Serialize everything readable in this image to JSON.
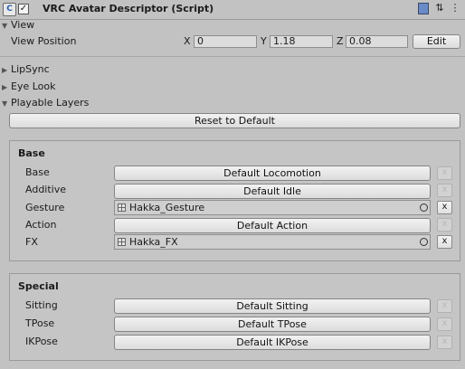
{
  "component": {
    "title": "VRC Avatar Descriptor (Script)",
    "icon": "script-icon",
    "enabled": true
  },
  "header_icons": [
    "help-book-icon",
    "preset-icon",
    "context-menu-icon"
  ],
  "view": {
    "foldout": "View",
    "position_label": "View Position",
    "x_label": "X",
    "x_value": "0",
    "y_label": "Y",
    "y_value": "1.18",
    "z_label": "Z",
    "z_value": "0.08",
    "edit_label": "Edit"
  },
  "foldouts": {
    "lipsync": "LipSync",
    "eye_look": "Eye Look",
    "playable_layers": "Playable Layers"
  },
  "reset_label": "Reset to Default",
  "base": {
    "title": "Base",
    "rows": [
      {
        "label": "Base",
        "value": "Default Locomotion",
        "type": "button"
      },
      {
        "label": "Additive",
        "value": "Default Idle",
        "type": "button"
      },
      {
        "label": "Gesture",
        "value": "Hakka_Gesture",
        "type": "object"
      },
      {
        "label": "Action",
        "value": "Default Action",
        "type": "button"
      },
      {
        "label": "FX",
        "value": "Hakka_FX",
        "type": "object"
      }
    ]
  },
  "special": {
    "title": "Special",
    "rows": [
      {
        "label": "Sitting",
        "value": "Default Sitting"
      },
      {
        "label": "TPose",
        "value": "Default TPose"
      },
      {
        "label": "IKPose",
        "value": "Default IKPose"
      }
    ]
  },
  "remove_label": "x"
}
